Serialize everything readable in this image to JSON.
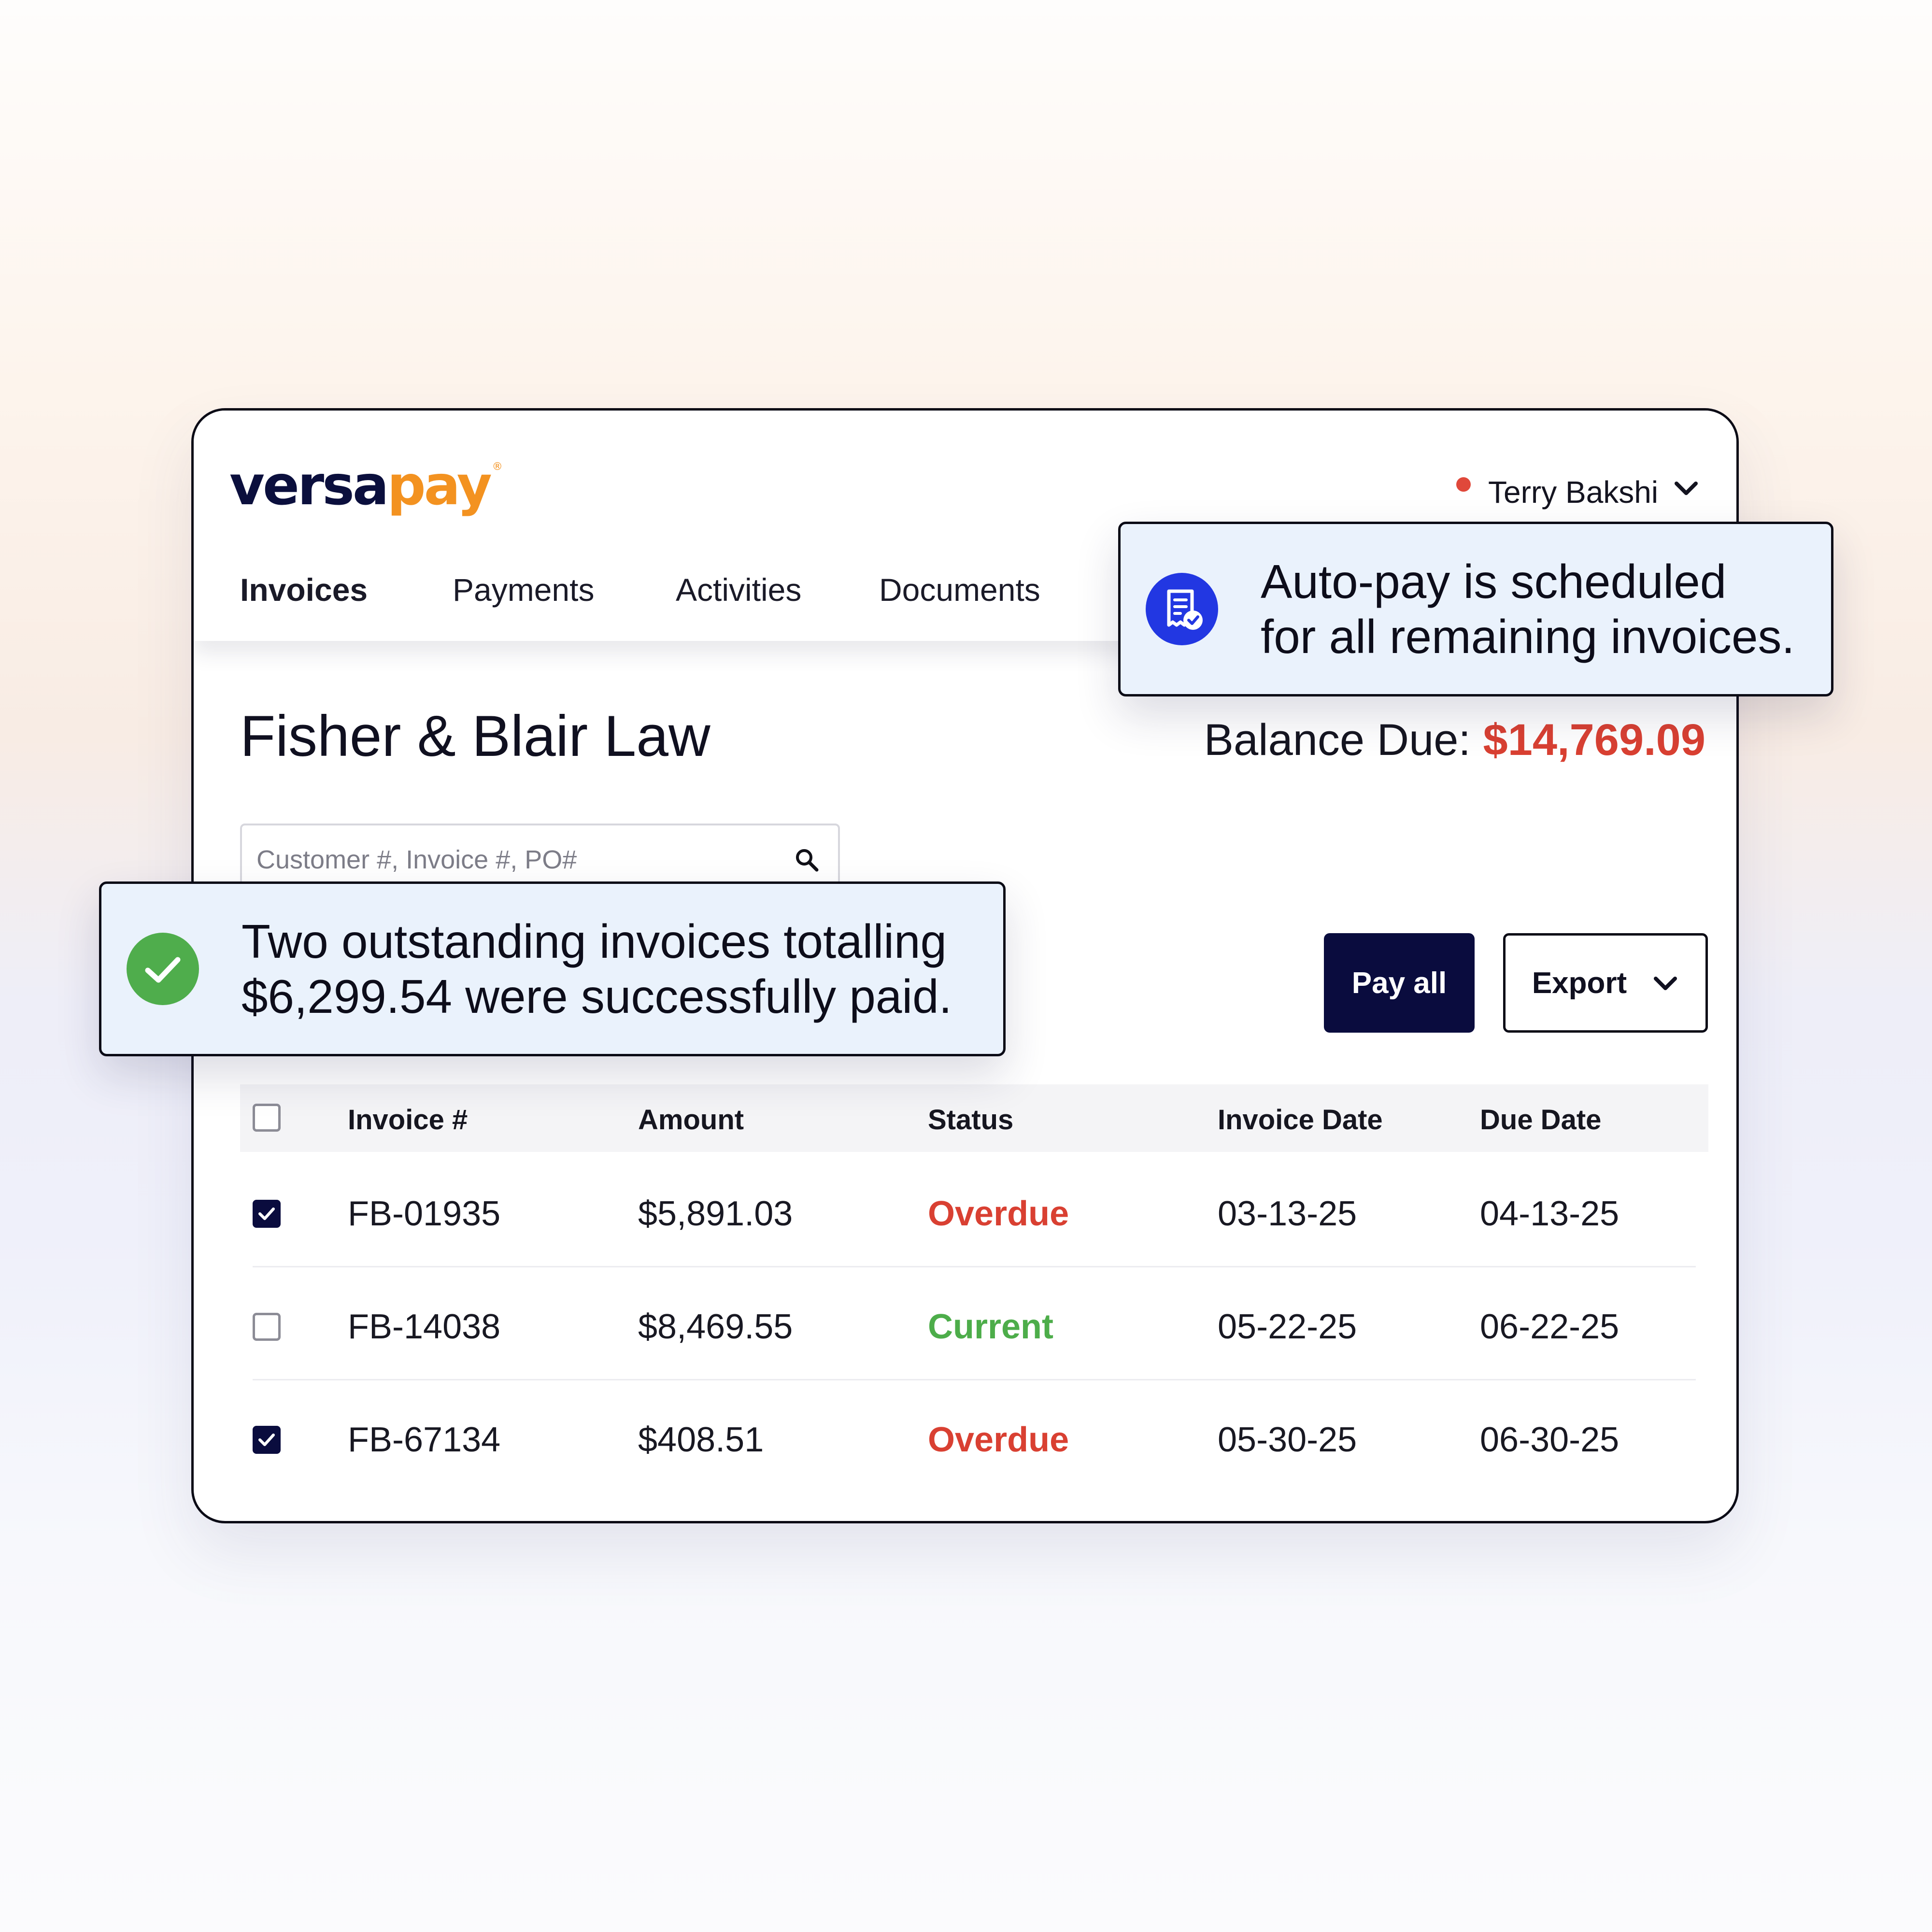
{
  "brand": {
    "logo_versa": "versa",
    "logo_pay": "pay",
    "logo_mark": "®",
    "primary_color": "#0a0c3e",
    "accent_color": "#f39220"
  },
  "user": {
    "name": "Terry Bakshi",
    "status_color": "#e0483a"
  },
  "nav": {
    "items": [
      {
        "label": "Invoices",
        "active": true
      },
      {
        "label": "Payments",
        "active": false
      },
      {
        "label": "Activities",
        "active": false
      },
      {
        "label": "Documents",
        "active": false
      }
    ]
  },
  "account": {
    "company": "Fisher & Blair Law",
    "balance_label": "Balance Due:",
    "balance_value": "$14,769.09",
    "balance_color": "#d94032"
  },
  "search": {
    "placeholder": "Customer #, Invoice #, PO#",
    "value": ""
  },
  "actions": {
    "pay_all_label": "Pay all",
    "export_label": "Export"
  },
  "table": {
    "headers": [
      "Invoice #",
      "Amount",
      "Status",
      "Invoice Date",
      "Due Date"
    ],
    "header_checked": false,
    "rows": [
      {
        "checked": true,
        "invoice": "FB-01935",
        "amount": "$5,891.03",
        "status": "Overdue",
        "invoice_date": "03-13-25",
        "due_date": "04-13-25"
      },
      {
        "checked": false,
        "invoice": "FB-14038",
        "amount": "$8,469.55",
        "status": "Current",
        "invoice_date": "05-22-25",
        "due_date": "06-22-25"
      },
      {
        "checked": true,
        "invoice": "FB-67134",
        "amount": "$408.51",
        "status": "Overdue",
        "invoice_date": "05-30-25",
        "due_date": "06-30-25"
      }
    ],
    "status_colors": {
      "Overdue": "#d94032",
      "Current": "#4dad4a"
    }
  },
  "notifications": {
    "autopay": {
      "icon": "receipt-check-icon",
      "line1": "Auto-pay is scheduled",
      "line2": "for all remaining invoices."
    },
    "paid": {
      "icon": "check-circle-icon",
      "line1": "Two outstanding invoices totalling",
      "line2": "$6,299.54 were successfully paid."
    }
  }
}
